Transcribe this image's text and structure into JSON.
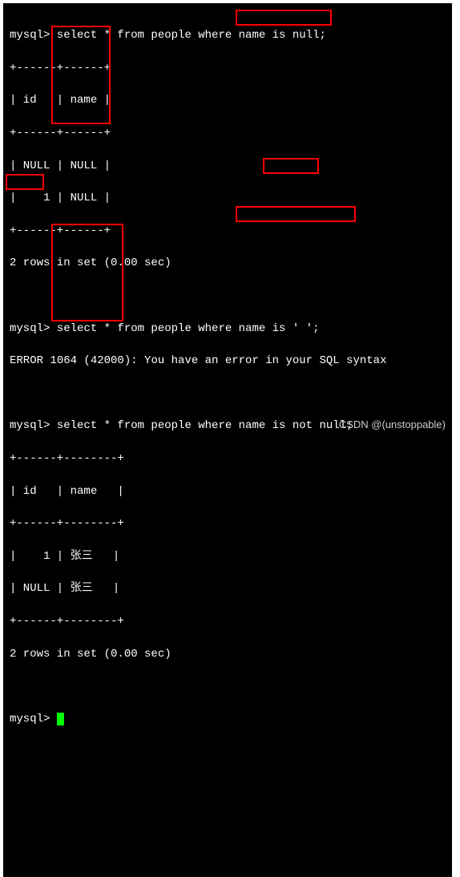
{
  "queries": {
    "q1": {
      "prompt": "mysql> ",
      "sql": "select * from people where name is null;",
      "highlight": "name is null",
      "separator": "+------+------+",
      "header": "| id   | name |",
      "rows": [
        "| NULL | NULL |",
        "|    1 | NULL |"
      ],
      "footer": "2 rows in set (0.00 sec)"
    },
    "q2": {
      "prompt": "mysql> ",
      "sql": "select * from people where name is ' ';",
      "highlight": "is ' '",
      "error_label": "ERROR",
      "error_rest": " 1064 (42000): You have an error in your SQL syntax"
    },
    "q3": {
      "prompt": "mysql> ",
      "sql": "select * from people where name is not null;",
      "highlight": "name is not null",
      "separator": "+------+--------+",
      "header": "| id   | name   |",
      "rows": [
        "|    1 | 张三   |",
        "| NULL | 张三   |"
      ],
      "footer": "2 rows in set (0.00 sec)"
    },
    "final_prompt": "mysql> "
  },
  "watermark": "CSDN @(unstoppable)"
}
